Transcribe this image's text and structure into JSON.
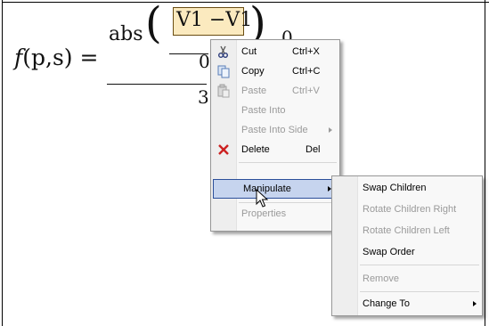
{
  "equation": {
    "lhs_func": "f",
    "lhs_args": "(p,s) =",
    "numerator_func": "abs",
    "selected_expr": "V1 −V1",
    "paren_left": "(",
    "paren_right": ")",
    "zero_right": "0",
    "zero_inner": "0",
    "denominator": "3"
  },
  "context_menu": {
    "items": [
      {
        "label": "Cut",
        "shortcut": "Ctrl+X",
        "icon": "scissors-icon",
        "enabled": true
      },
      {
        "label": "Copy",
        "shortcut": "Ctrl+C",
        "icon": "copy-icon",
        "enabled": true
      },
      {
        "label": "Paste",
        "shortcut": "Ctrl+V",
        "icon": "paste-icon",
        "enabled": false
      },
      {
        "label": "Paste Into",
        "shortcut": "",
        "enabled": false
      },
      {
        "label": "Paste Into Side",
        "shortcut": "",
        "enabled": false,
        "submenu": true
      },
      {
        "label": "Delete",
        "shortcut": "Del",
        "icon": "delete-x-icon",
        "enabled": true
      },
      {
        "label": "Manipulate",
        "enabled": true,
        "submenu": true,
        "highlighted": true
      },
      {
        "label": "Properties",
        "enabled": false
      }
    ]
  },
  "submenu": {
    "items": [
      {
        "label": "Swap Children",
        "enabled": true
      },
      {
        "label": "Rotate Children Right",
        "enabled": false
      },
      {
        "label": "Rotate Children Left",
        "enabled": false
      },
      {
        "label": "Swap Order",
        "enabled": true
      },
      {
        "label": "Remove",
        "enabled": false
      },
      {
        "label": "Change To",
        "enabled": true,
        "submenu": true
      }
    ]
  },
  "colors": {
    "selection_fill": "#fbeabf",
    "selection_border": "#6b4d12",
    "highlight_fill": "#c6d4ee",
    "delete_icon": "#cc2020"
  }
}
